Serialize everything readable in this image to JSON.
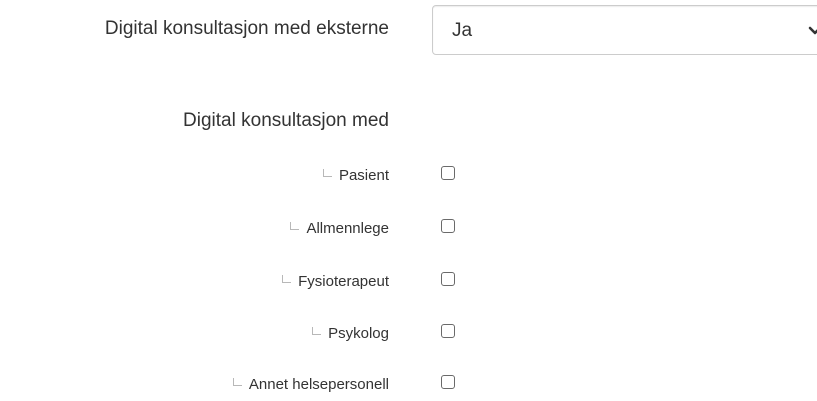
{
  "form": {
    "external_consult": {
      "label": "Digital konsultasjon med eksterne",
      "selected_value": "Ja",
      "chevron_icon": "chevron-down-icon"
    },
    "consult_with": {
      "label": "Digital konsultasjon med",
      "branch_icon": "tree-branch-icon",
      "options": [
        {
          "label": "Pasient",
          "checked": false
        },
        {
          "label": "Allmennlege",
          "checked": false
        },
        {
          "label": "Fysioterapeut",
          "checked": false
        },
        {
          "label": "Psykolog",
          "checked": false
        },
        {
          "label": "Annet helsepersonell",
          "checked": false
        }
      ]
    }
  }
}
